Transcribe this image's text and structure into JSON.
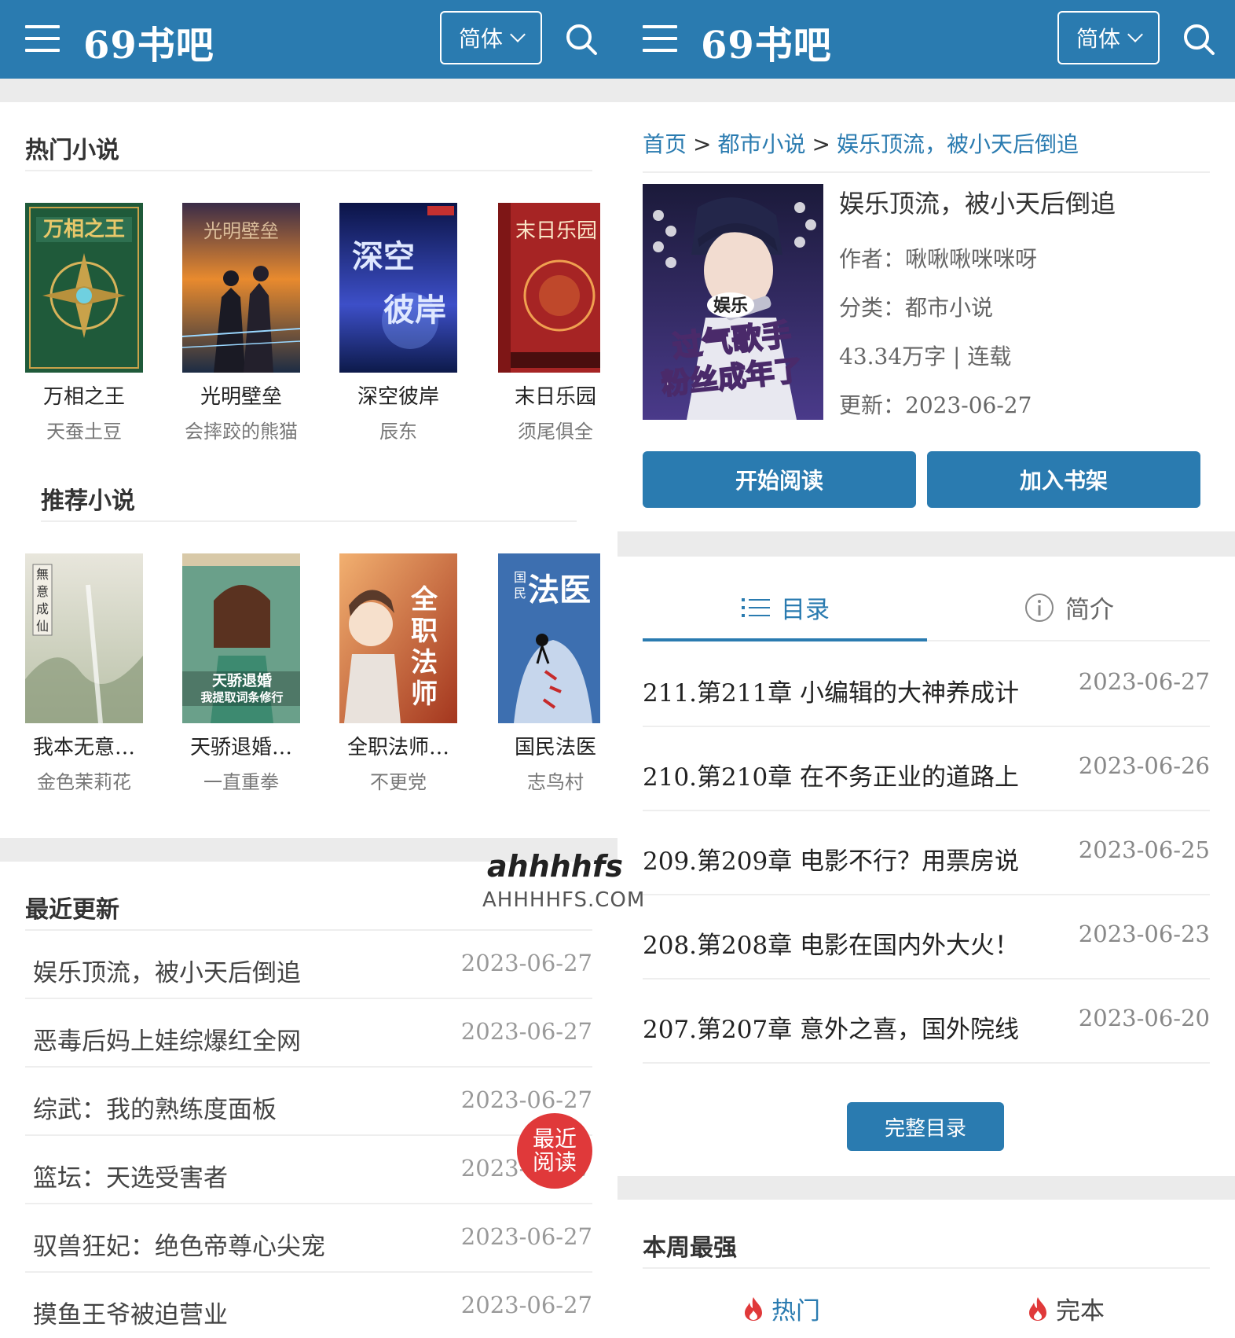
{
  "header": {
    "logo": "69书吧",
    "lang_label": "简体",
    "menu_icon": "menu-icon",
    "search_icon": "search-icon"
  },
  "left": {
    "hot": {
      "title": "热门小说",
      "books": [
        {
          "title": "万相之王",
          "author": "天蚕土豆"
        },
        {
          "title": "光明壁垒",
          "author": "会摔跤的熊猫"
        },
        {
          "title": "深空彼岸",
          "author": "辰东"
        },
        {
          "title": "末日乐园",
          "author": "须尾俱全"
        }
      ]
    },
    "recommend": {
      "title": "推荐小说",
      "books": [
        {
          "title": "我本无意…",
          "author": "金色茉莉花"
        },
        {
          "title": "天骄退婚…",
          "author": "一直重拳"
        },
        {
          "title": "全职法师…",
          "author": "不更党"
        },
        {
          "title": "国民法医",
          "author": "志鸟村"
        }
      ]
    },
    "recent": {
      "title": "最近更新",
      "rows": [
        {
          "name": "娱乐顶流，被小天后倒追",
          "date": "2023-06-27"
        },
        {
          "name": "恶毒后妈上娃综爆红全网",
          "date": "2023-06-27"
        },
        {
          "name": "综武：我的熟练度面板",
          "date": "2023-06-27"
        },
        {
          "name": "篮坛：天选受害者",
          "date": "2023-06-27"
        },
        {
          "name": "驭兽狂妃：绝色帝尊心尖宠",
          "date": "2023-06-27"
        },
        {
          "name": "摸鱼王爷被迫营业",
          "date": "2023-06-27"
        }
      ]
    },
    "fab_label_1": "最近",
    "fab_label_2": "阅读",
    "watermark_top": "ahhhhfs",
    "watermark_bottom": "AHHHHFS.COM"
  },
  "right": {
    "breadcrumb": [
      "首页",
      "都市小说",
      "娱乐顶流，被小天后倒追"
    ],
    "breadcrumb_sep": ">",
    "book": {
      "title": "娱乐顶流，被小天后倒追",
      "author_line": "作者：啾啾啾咪咪呀",
      "category_line": "分类：都市小说",
      "stats_line": "43.34万字 | 连载",
      "update_line": "更新：2023-06-27",
      "cover_text_1": "娱乐",
      "cover_text_2": "过气歌手",
      "cover_text_3": "粉丝成年了"
    },
    "buttons": {
      "read": "开始阅读",
      "shelf": "加入书架"
    },
    "tabs": {
      "toc": "目录",
      "intro": "简介"
    },
    "chapters": [
      {
        "name": "211.第211章 小编辑的大神养成计",
        "date": "2023-06-27"
      },
      {
        "name": "210.第210章 在不务正业的道路上",
        "date": "2023-06-26"
      },
      {
        "name": "209.第209章 电影不行？用票房说",
        "date": "2023-06-25"
      },
      {
        "name": "208.第208章 电影在国内外大火！",
        "date": "2023-06-23"
      },
      {
        "name": "207.第207章 意外之喜，国外院线",
        "date": "2023-06-20"
      }
    ],
    "full_toc": "完整目录",
    "weekly": {
      "title": "本周最强",
      "tabs": [
        "热门",
        "完本"
      ]
    }
  },
  "colors": {
    "brand": "#2a7bb0",
    "fab": "#e0393a",
    "flame": "#e0393a"
  }
}
